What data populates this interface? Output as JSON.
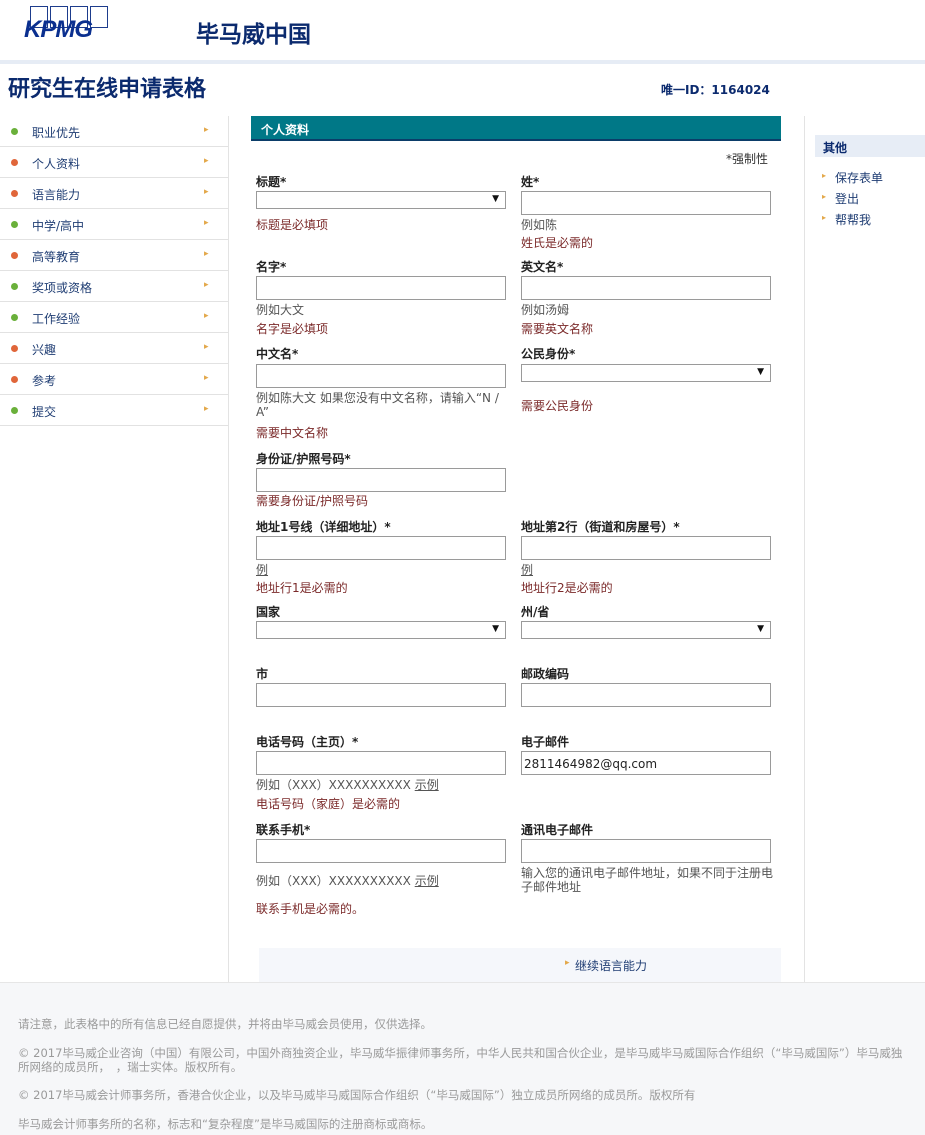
{
  "header": {
    "logo_text": "KPMG",
    "brand": "毕马威中国"
  },
  "page": {
    "title": "研究生在线申请表格",
    "unique_id": "唯一ID：1164024"
  },
  "nav": {
    "items": [
      {
        "label": "职业优先",
        "dot": "#6ab03a"
      },
      {
        "label": "个人资料",
        "dot": "#e0663a"
      },
      {
        "label": "语言能力",
        "dot": "#e0663a"
      },
      {
        "label": "中学/高中",
        "dot": "#6ab03a"
      },
      {
        "label": "高等教育",
        "dot": "#e0663a"
      },
      {
        "label": "奖项或资格",
        "dot": "#6ab03a"
      },
      {
        "label": "工作经验",
        "dot": "#6ab03a"
      },
      {
        "label": "兴趣",
        "dot": "#e0663a"
      },
      {
        "label": "参考",
        "dot": "#e0663a"
      },
      {
        "label": "提交",
        "dot": "#6ab03a"
      }
    ],
    "chevron": "▸"
  },
  "aside": {
    "heading": "其他",
    "links": [
      "保存表单",
      "登出",
      "帮帮我"
    ]
  },
  "form": {
    "section_title": "个人资料",
    "mandatory_note": "*强制性",
    "title_label": "标题*",
    "title_error": "标题是必填项",
    "surname_label": "姓*",
    "surname_hint": "例如陈",
    "surname_error": "姓氏是必需的",
    "given_label": "名字*",
    "given_hint": "例如大文",
    "given_error": "名字是必填项",
    "english_label": "英文名*",
    "english_hint": "例如汤姆",
    "english_error": "需要英文名称",
    "chinese_label": "中文名*",
    "chinese_hint": "例如陈大文 如果您没有中文名称，请输入“N / A”",
    "chinese_error": "需要中文名称",
    "citizen_label": "公民身份*",
    "citizen_error": "需要公民身份",
    "id_label": "身份证/护照号码*",
    "id_error": "需要身份证/护照号码",
    "addr1_label": "地址1号线（详细地址）*",
    "addr1_hint": "例",
    "addr1_error": "地址行1是必需的",
    "addr2_label": "地址第2行（街道和房屋号）*",
    "addr2_hint": "例",
    "addr2_error": "地址行2是必需的",
    "country_label": "国家",
    "state_label": "州/省",
    "city_label": "市",
    "postcode_label": "邮政编码",
    "phone_label": "电话号码（主页）*",
    "phone_hint": "例如（XXX）XXXXXXXXXX",
    "phone_example": "示例",
    "phone_error": "电话号码（家庭）是必需的",
    "email_label": "电子邮件",
    "email_value": "2811464982@qq.com",
    "mobile_label": "联系手机*",
    "mobile_hint": "例如（XXX）XXXXXXXXXX",
    "mobile_example": "示例",
    "mobile_error": "联系手机是必需的。",
    "comm_email_label": "通讯电子邮件",
    "comm_email_hint": "输入您的通讯电子邮件地址，如果不同于注册电子邮件地址"
  },
  "continue_label": "继续语言能力",
  "footer": {
    "note1": "请注意，此表格中的所有信息已经自愿提供，并将由毕马威会员使用，仅供选择。",
    "note2": "© 2017毕马威企业咨询（中国）有限公司，中国外商独资企业，毕马威华振律师事务所，中华人民共和国合伙企业，是毕马威毕马威国际合作组织（“毕马威国际”）毕马威独",
    "note2b": "所网络的成员所，　，瑞士实体。版权所有。",
    "note3": "© 2017毕马威会计师事务所，香港合伙企业，以及毕马威毕马威国际合作组织（“毕马威国际”）独立成员所网络的成员所。版权所有",
    "note4": "毕马威会计师事务所的名称，标志和“复杂程度”是毕马威国际的注册商标或商标。"
  }
}
